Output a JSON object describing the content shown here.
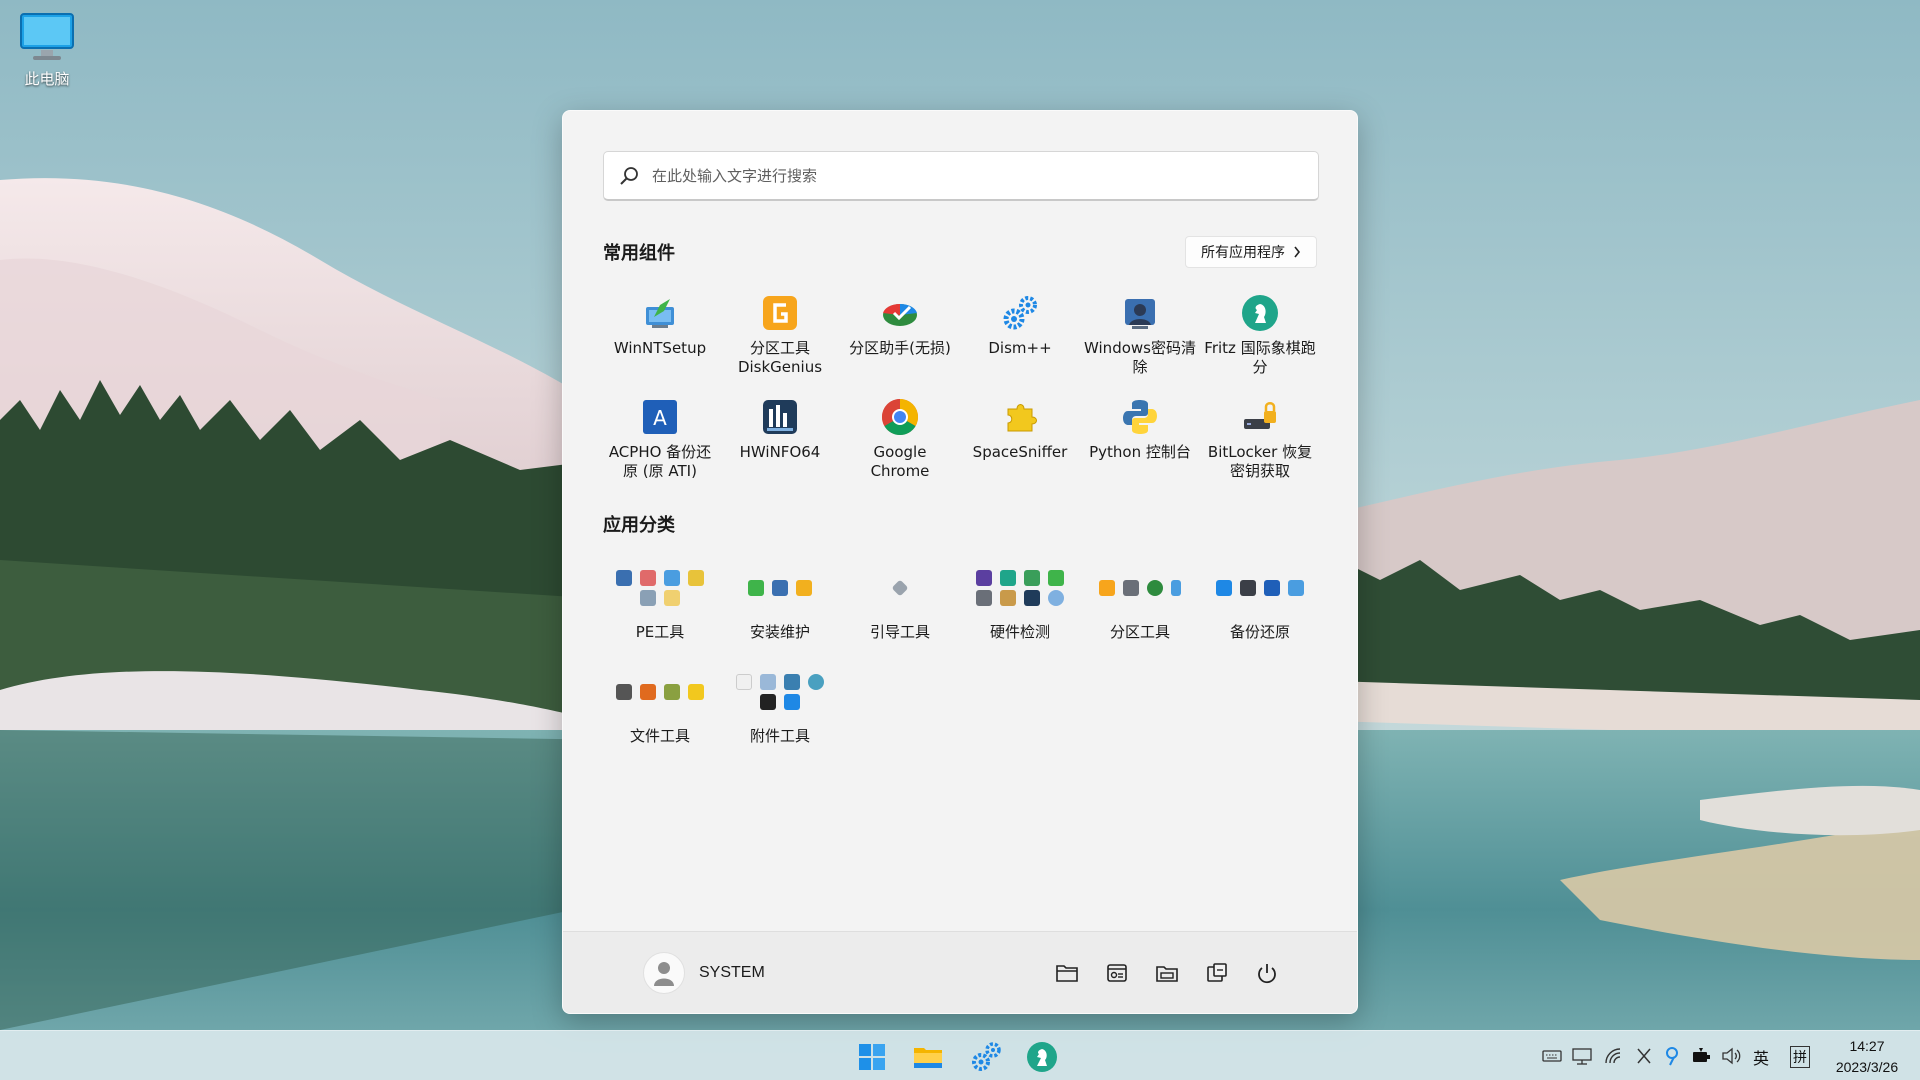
{
  "desktop": {
    "icons": [
      {
        "label": "此电脑",
        "icon": "monitor-icon"
      }
    ]
  },
  "start_menu": {
    "search": {
      "placeholder": "在此处输入文字进行搜索"
    },
    "pinned": {
      "title": "常用组件",
      "all_apps_label": "所有应用程序",
      "apps": [
        {
          "label": "WinNTSetup",
          "icon": "winntsetup-icon"
        },
        {
          "label": "分区工具 DiskGenius",
          "icon": "diskgenius-icon"
        },
        {
          "label": "分区助手(无损)",
          "icon": "partition-assistant-icon"
        },
        {
          "label": "Dism++",
          "icon": "dism-gear-icon"
        },
        {
          "label": "Windows密码清除",
          "icon": "password-clear-icon"
        },
        {
          "label": "Fritz 国际象棋跑分",
          "icon": "fritz-chess-icon"
        },
        {
          "label": "ACPHO 备份还原 (原 ATI)",
          "icon": "acpho-icon"
        },
        {
          "label": "HWiNFO64",
          "icon": "hwinfo-icon"
        },
        {
          "label": "Google Chrome",
          "icon": "chrome-icon"
        },
        {
          "label": "SpaceSniffer",
          "icon": "spacesniffer-icon"
        },
        {
          "label": "Python 控制台",
          "icon": "python-icon"
        },
        {
          "label": "BitLocker 恢复密钥获取",
          "icon": "bitlocker-icon"
        }
      ]
    },
    "categories": {
      "title": "应用分类",
      "items": [
        {
          "label": "PE工具",
          "icon": "folder-pe-tools-icon"
        },
        {
          "label": "安装维护",
          "icon": "folder-install-icon"
        },
        {
          "label": "引导工具",
          "icon": "folder-boot-icon"
        },
        {
          "label": "硬件检测",
          "icon": "folder-hardware-icon"
        },
        {
          "label": "分区工具",
          "icon": "folder-partition-icon"
        },
        {
          "label": "备份还原",
          "icon": "folder-backup-icon"
        },
        {
          "label": "文件工具",
          "icon": "folder-file-tools-icon"
        },
        {
          "label": "附件工具",
          "icon": "folder-accessories-icon"
        }
      ]
    },
    "footer": {
      "user": "SYSTEM",
      "buttons": [
        "folder-icon",
        "control-panel-icon",
        "explorer-icon",
        "task-manager-icon",
        "power-icon"
      ]
    }
  },
  "taskbar": {
    "apps": [
      "windows-start-icon",
      "file-explorer-icon",
      "dism-gear-icon",
      "fritz-chess-icon"
    ],
    "tray": {
      "icons": [
        "keyboard-icon",
        "network-monitor-icon",
        "wifi-icon",
        "x-icon",
        "location-icon",
        "battery-icon",
        "volume-icon"
      ],
      "ime_lang": "英",
      "ime_mode": "拼"
    },
    "clock": {
      "time": "14:27",
      "date": "2023/3/26"
    }
  },
  "colors": {
    "accent": "#0078d4",
    "menu_bg": "#f3f3f3",
    "taskbar_bg": "#cee2e6"
  }
}
